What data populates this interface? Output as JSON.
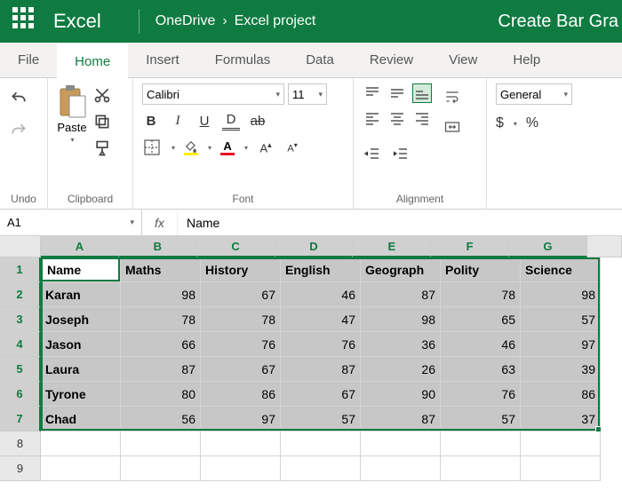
{
  "titlebar": {
    "app": "Excel",
    "location": "OneDrive",
    "folder": "Excel project",
    "doc": "Create Bar Gra"
  },
  "tabs": [
    "File",
    "Home",
    "Insert",
    "Formulas",
    "Data",
    "Review",
    "View",
    "Help"
  ],
  "active_tab": 1,
  "ribbon": {
    "undo_label": "Undo",
    "clipboard_label": "Clipboard",
    "paste_label": "Paste",
    "font_label": "Font",
    "font_name": "Calibri",
    "font_size": "11",
    "alignment_label": "Alignment",
    "number_format": "General"
  },
  "namebox": "A1",
  "formula_value": "Name",
  "columns": [
    "A",
    "B",
    "C",
    "D",
    "E",
    "F",
    "G"
  ],
  "sel_cols": 7,
  "row_numbers": [
    "1",
    "2",
    "3",
    "4",
    "5",
    "6",
    "7",
    "8",
    "9"
  ],
  "sel_rows": 7,
  "headers": [
    "Name",
    "Maths",
    "History",
    "English",
    "Geograph",
    "Polity",
    "Science"
  ],
  "data_rows": [
    {
      "name": "Karan",
      "vals": [
        98,
        67,
        46,
        87,
        78,
        98
      ]
    },
    {
      "name": "Joseph",
      "vals": [
        78,
        78,
        47,
        98,
        65,
        57
      ]
    },
    {
      "name": "Jason",
      "vals": [
        66,
        76,
        76,
        36,
        46,
        97
      ]
    },
    {
      "name": "Laura",
      "vals": [
        87,
        67,
        87,
        26,
        63,
        39
      ]
    },
    {
      "name": "Tyrone",
      "vals": [
        80,
        86,
        67,
        90,
        76,
        86
      ]
    },
    {
      "name": "Chad",
      "vals": [
        56,
        97,
        57,
        87,
        57,
        37
      ]
    }
  ]
}
